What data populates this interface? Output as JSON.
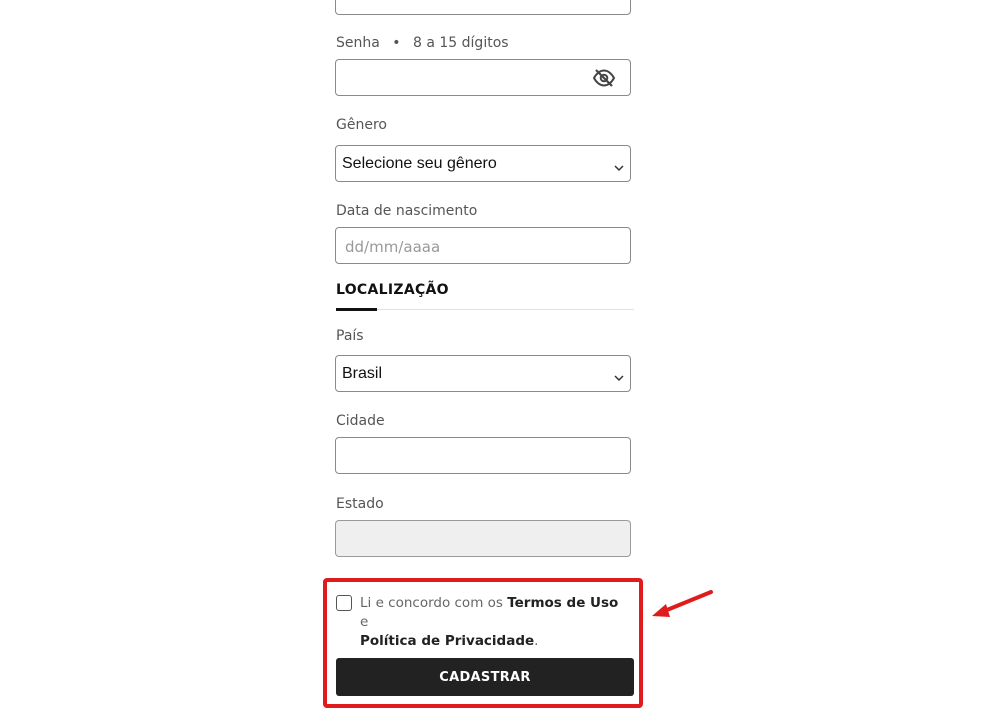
{
  "password": {
    "label": "Senha",
    "separator": "•",
    "hint": "8 a 15 dígitos",
    "toggle_icon": "eye-slash-icon"
  },
  "gender": {
    "label": "Gênero",
    "selected": "Selecione seu gênero"
  },
  "birthdate": {
    "label": "Data de nascimento",
    "placeholder": "dd/mm/aaaa"
  },
  "location": {
    "section_title": "LOCALIZAÇÃO",
    "country_label": "País",
    "country_selected": "Brasil",
    "city_label": "Cidade",
    "state_label": "Estado"
  },
  "terms": {
    "prefix": "Li e concordo com os ",
    "terms_link": "Termos de Uso",
    "middle": " e ",
    "privacy_link": "Política de Privacidade",
    "suffix": "."
  },
  "submit_label": "CADASTRAR",
  "annotation": {
    "highlight_color": "#e01b1b"
  }
}
